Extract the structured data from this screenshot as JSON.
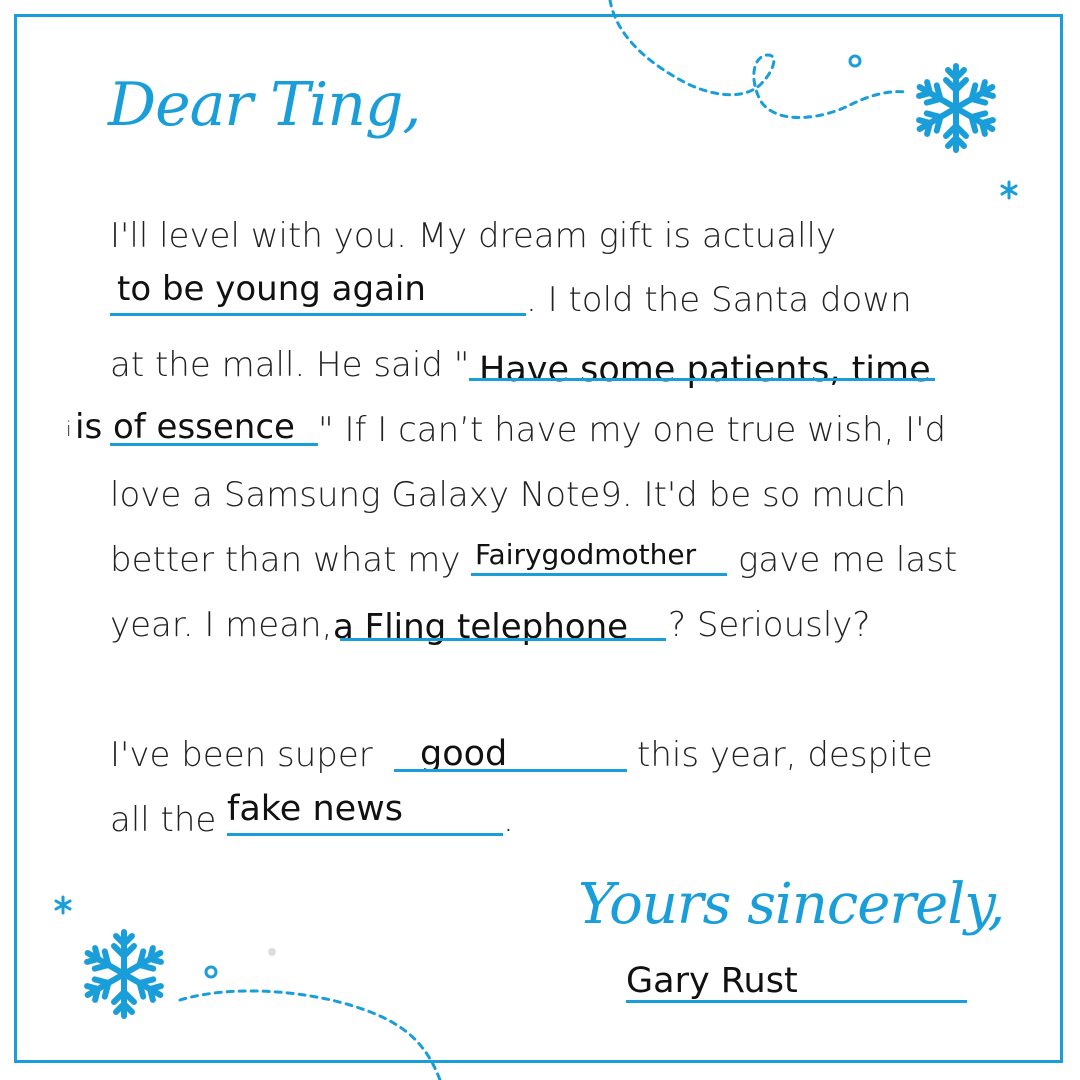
{
  "letter": {
    "greeting": "Dear Ting,",
    "body_lines": {
      "l1": "I'll level with you. My dream gift is actually",
      "l2_tail": ". I told the Santa down",
      "l3_head": "at the mall. He said \"",
      "l4_head": "i",
      "l4_tail": "\" If I can’t have my one true wish, I'd",
      "l5": "love a Samsung Galaxy Note9. It'd be so much",
      "l6_head": "better than what my",
      "l6_tail": "gave me last",
      "l7_head": "year. I mean,",
      "l7_tail": "? Seriously?",
      "l8_head": "I've been super",
      "l8_tail": "this year, despite",
      "l9_head": "all the",
      "l9_tail": "."
    },
    "filled_in": {
      "dream_gift": "to be young again",
      "santa_quote_part1": "Have some patients, time",
      "santa_quote_part2": "is of essence",
      "last_year_giver": "Fairygodmother",
      "last_year_gift": "a Fling telephone",
      "behavior": "good",
      "despite": "fake news",
      "signature_name": "Gary Rust"
    },
    "closing": "Yours sincerely,"
  },
  "colors": {
    "accent": "#1a9ed9",
    "text": "#222222"
  },
  "icons": [
    "snowflake-icon",
    "asterisk-snowflake-icon",
    "dotted-swirl-line"
  ]
}
